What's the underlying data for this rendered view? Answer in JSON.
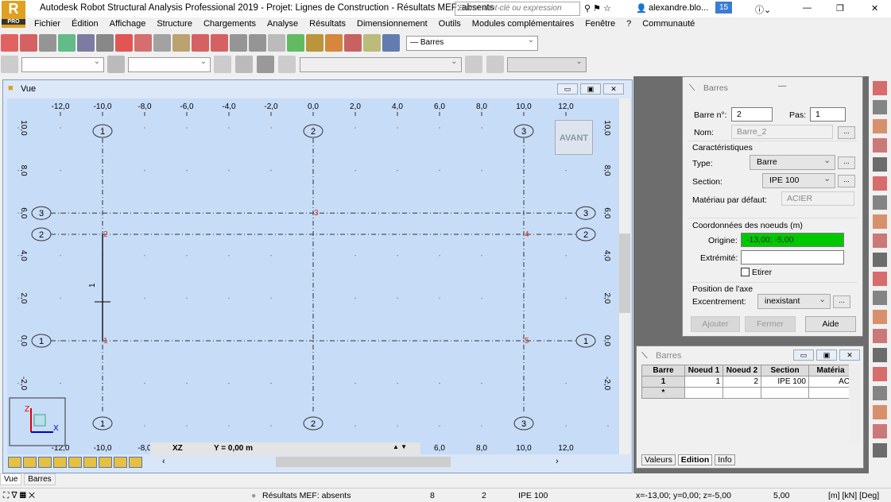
{
  "window": {
    "title": "Autodesk Robot Structural Analysis Professional 2019 - Projet: Lignes de Construction - Résultats MEF: absents",
    "search_placeholder": "Entrez mot-clé ou expression",
    "user": "alexandre.blo...",
    "badge": "15",
    "logo": "R",
    "logo_sub": "PRO"
  },
  "menu": [
    "Fichier",
    "Édition",
    "Affichage",
    "Structure",
    "Chargements",
    "Analyse",
    "Résultats",
    "Dimensionnement",
    "Outils",
    "Modules complémentaires",
    "Fenêtre",
    "?",
    "Communauté"
  ],
  "toolbar": {
    "selection_combo": "— Barres"
  },
  "view": {
    "title": "Vue",
    "view_button": "AVANT",
    "plane": "XZ",
    "coord": "Y = 0,00 m",
    "unit_hint": "[m]",
    "x_ticks": [
      "-12,0",
      "-10,0",
      "-8,0",
      "-6,0",
      "-4,0",
      "-2,0",
      "0,0",
      "2,0",
      "4,0",
      "6,0",
      "8,0",
      "10,0",
      "12,0"
    ],
    "y_ticks": [
      "10,0",
      "8,0",
      "6,0",
      "4,0",
      "2,0",
      "0,0",
      "-2,0"
    ],
    "bottom_ticks": [
      "-12,0",
      "-10,0",
      "-8,0",
      "6,0",
      "8,0",
      "10,0",
      "12,0"
    ],
    "vertical_axes": [
      {
        "label": "1",
        "x": -10
      },
      {
        "label": "2",
        "x": 0
      },
      {
        "label": "3",
        "x": 10
      }
    ],
    "horizontal_axes": [
      {
        "label": "3",
        "y": 6
      },
      {
        "label": "2",
        "y": 5
      },
      {
        "label": "1",
        "y": 0
      }
    ],
    "nodes": [
      {
        "id": "1",
        "x": -10,
        "z": 0
      },
      {
        "id": "2",
        "x": -10,
        "z": 5
      },
      {
        "id": "3",
        "x": 0,
        "z": 6
      },
      {
        "id": "4",
        "x": 10,
        "z": 5
      },
      {
        "id": "5",
        "x": 10,
        "z": 0
      }
    ],
    "bars": [
      {
        "id": "1",
        "from": "1",
        "to": "2"
      }
    ],
    "axis_labels": {
      "x": "X",
      "z": "Z"
    }
  },
  "bottom_tabs": [
    "Vue",
    "Barres"
  ],
  "dialog": {
    "title": "Barres",
    "bar_no_label": "Barre n°:",
    "bar_no": "2",
    "step_label": "Pas:",
    "step": "1",
    "name_label": "Nom:",
    "name": "Barre_2",
    "group_char": "Caractéristiques",
    "type_label": "Type:",
    "type": "Barre",
    "section_label": "Section:",
    "section": "IPE 100",
    "material_label": "Matériau par défaut:",
    "material": "ACIER",
    "group_coords": "Coordonnées des noeuds (m)",
    "origin_label": "Origine:",
    "origin": "-13,00; -5,00",
    "end_label": "Extrémité:",
    "end": "",
    "stretch_label": "Etirer",
    "group_axis": "Position de l'axe",
    "offset_label": "Excentrement:",
    "offset": "inexistant",
    "more": "...",
    "add": "Ajouter",
    "close": "Fermer",
    "help": "Aide",
    "origin_color": "#00c800"
  },
  "table": {
    "title": "Barres",
    "headers": [
      "Barre",
      "Noeud 1",
      "Noeud 2",
      "Section",
      "Matéria"
    ],
    "rows": [
      [
        "1",
        "1",
        "2",
        "IPE 100",
        "AC"
      ],
      [
        "*",
        "",
        "",
        "",
        ""
      ]
    ],
    "tabs": [
      "Valeurs",
      "Edition",
      "Info"
    ]
  },
  "status": {
    "results": "Résultats MEF: absents",
    "count": "8",
    "bar": "2",
    "section": "IPE 100",
    "coords": "x=-13,00; y=0,00; z=-5,00",
    "length": "5,00",
    "units": "[m] [kN] [Deg]"
  }
}
